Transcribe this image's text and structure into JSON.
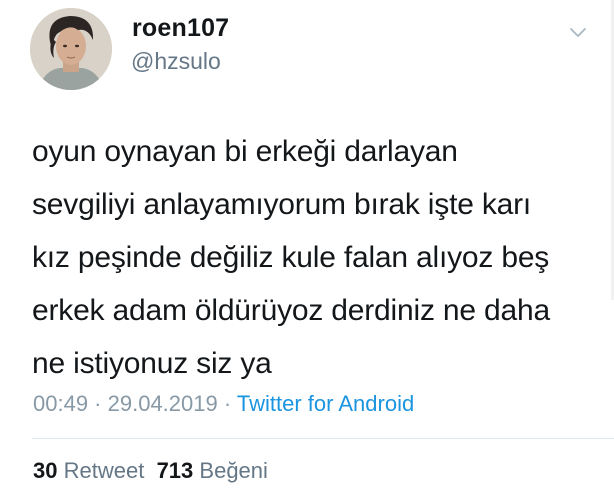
{
  "author": {
    "display_name": "roen107",
    "username": "@hzsulo"
  },
  "tweet": {
    "lines": [
      "oyun oynayan bi erkeği darlayan",
      "sevgiliyi anlayamıyorum bırak işte karı",
      "kız peşinde değiliz kule falan alıyoz beş",
      "erkek adam öldürüyoz derdiniz ne daha",
      "ne istiyonuz siz ya"
    ]
  },
  "meta": {
    "time": "00:49",
    "sep1": " · ",
    "date": "29.04.2019",
    "sep2": " · ",
    "source": "Twitter for Android"
  },
  "stats": {
    "retweet_count": "30",
    "retweet_label": "Retweet",
    "like_count": "713",
    "like_label": "Beğeni"
  },
  "icons": {
    "menu": "chevron-down-icon"
  },
  "colors": {
    "text": "#14171a",
    "secondary": "#657786",
    "link": "#1b95e0"
  }
}
